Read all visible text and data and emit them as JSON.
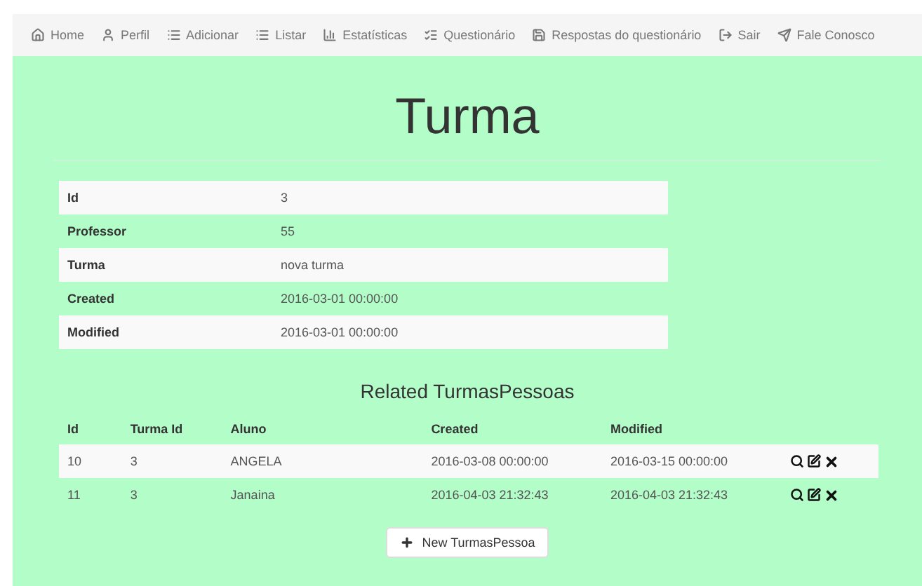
{
  "nav": [
    {
      "label": "Home"
    },
    {
      "label": "Perfil"
    },
    {
      "label": "Adicionar"
    },
    {
      "label": "Listar"
    },
    {
      "label": "Estatísticas"
    },
    {
      "label": "Questionário"
    },
    {
      "label": "Respostas do questionário"
    },
    {
      "label": "Sair"
    },
    {
      "label": "Fale Conosco"
    }
  ],
  "title": "Turma",
  "details": [
    {
      "label": "Id",
      "value": "3"
    },
    {
      "label": "Professor",
      "value": "55"
    },
    {
      "label": "Turma",
      "value": "nova turma"
    },
    {
      "label": "Created",
      "value": "2016-03-01 00:00:00"
    },
    {
      "label": "Modified",
      "value": "2016-03-01 00:00:00"
    }
  ],
  "related": {
    "title": "Related TurmasPessoas",
    "columns": [
      "Id",
      "Turma Id",
      "Aluno",
      "Created",
      "Modified"
    ],
    "rows": [
      [
        "10",
        "3",
        "ANGELA",
        "2016-03-08 00:00:00",
        "2016-03-15 00:00:00"
      ],
      [
        "11",
        "3",
        "Janaina",
        "2016-04-03 21:32:43",
        "2016-04-03 21:32:43"
      ]
    ],
    "new_button": "New TurmasPessoa"
  }
}
